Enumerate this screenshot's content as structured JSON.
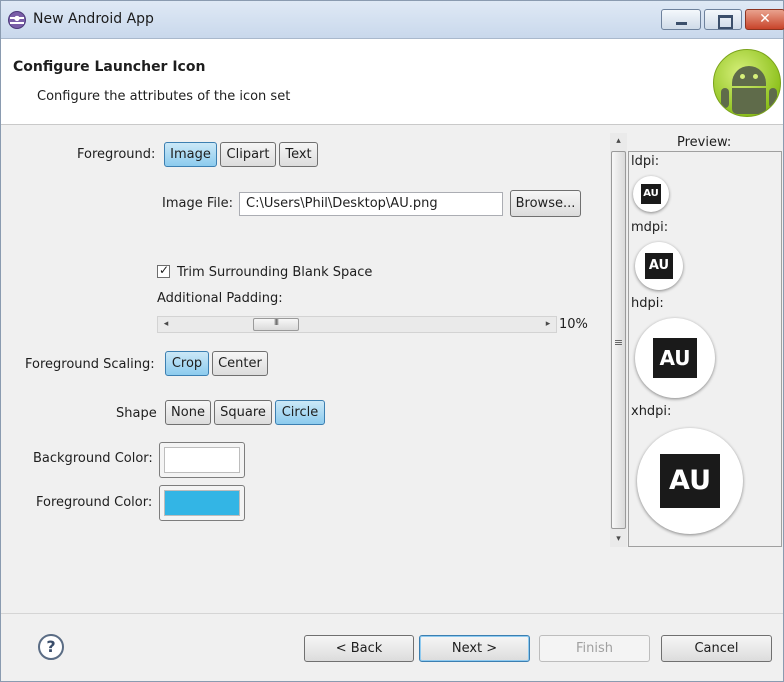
{
  "window": {
    "title": "New Android App",
    "close_glyph": "✕"
  },
  "header": {
    "title": "Configure Launcher Icon",
    "subtitle": "Configure the attributes of the icon set"
  },
  "foreground": {
    "label": "Foreground:",
    "options": [
      "Image",
      "Clipart",
      "Text"
    ],
    "selected": "Image"
  },
  "image_file": {
    "label": "Image File:",
    "value": "C:\\Users\\Phil\\Desktop\\AU.png",
    "browse_label": "Browse..."
  },
  "trim": {
    "label": "Trim Surrounding Blank Space",
    "checked": true
  },
  "padding": {
    "label": "Additional Padding:",
    "value_text": "10%",
    "value": 10,
    "left_arrow": "◂",
    "right_arrow": "▸"
  },
  "scaling": {
    "label": "Foreground Scaling:",
    "options": [
      "Crop",
      "Center"
    ],
    "selected": "Crop"
  },
  "shape": {
    "label": "Shape",
    "options": [
      "None",
      "Square",
      "Circle"
    ],
    "selected": "Circle"
  },
  "background_color": {
    "label": "Background Color:",
    "color": "#ffffff"
  },
  "foreground_color": {
    "label": "Foreground Color:",
    "color": "#33b5e5"
  },
  "preview": {
    "title": "Preview:",
    "icon_text": "AU",
    "densities": [
      "ldpi:",
      "mdpi:",
      "hdpi:",
      "xhdpi:"
    ],
    "up_arrow": "▴",
    "down_arrow": "▾"
  },
  "footer": {
    "help_glyph": "?",
    "back_label": "< Back",
    "next_label": "Next >",
    "finish_label": "Finish",
    "cancel_label": "Cancel"
  },
  "icons": [
    "app-icon",
    "android-logo",
    "help-icon",
    "minimize-icon",
    "maximize-icon",
    "close-icon"
  ]
}
